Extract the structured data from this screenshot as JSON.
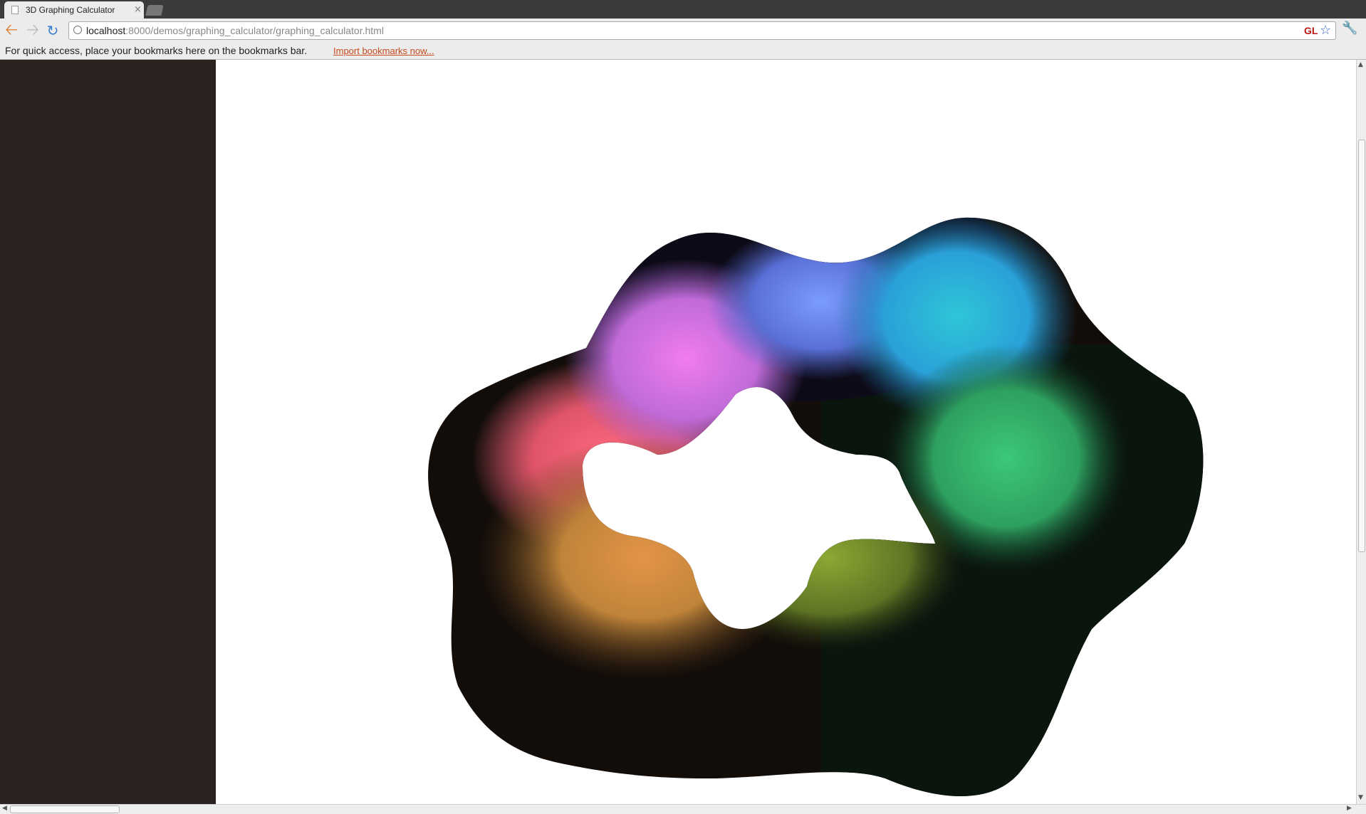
{
  "browser": {
    "tab_title": "3D Graphing Calculator",
    "tab_close": "×",
    "url_host": "localhost",
    "url_rest": ":8000/demos/graphing_calculator/graphing_calculator.html",
    "gl_badge": "GL"
  },
  "bookmarks_bar": {
    "prompt": "For quick access, place your bookmarks here on the bookmarks bar.",
    "import_link": "Import bookmarks now..."
  },
  "icons": {
    "back": "back-arrow-icon",
    "forward": "forward-arrow-icon",
    "reload": "reload-icon",
    "bookmark_star": "star-icon",
    "settings": "wrench-icon",
    "page": "page-icon",
    "site_info": "globe-icon"
  },
  "colors": {
    "sidebar": "#2a2320",
    "surface_pink": "#ff6a80",
    "surface_magenta": "#f07cf0",
    "surface_blue": "#6a90ff",
    "surface_cyan": "#2ec6d8",
    "surface_green": "#38c474",
    "surface_orange": "#e19248",
    "surface_olive": "#8ca834"
  }
}
